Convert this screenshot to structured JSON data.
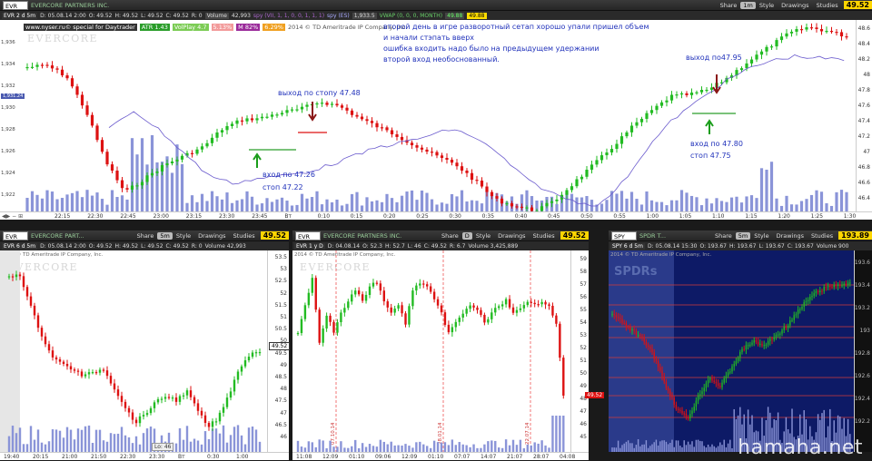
{
  "top": {
    "toolbar": {
      "symbol": "EVR",
      "company": "EVERCORE PARTNERS INC.",
      "share": "Share",
      "period": "1m",
      "style": "Style",
      "drawings": "Drawings",
      "studies": "Studies",
      "price": "49.52"
    },
    "quote": {
      "period_label": "EVR 2 d 5m",
      "d": "D: 05.08.14 2:00",
      "o": "O: 49.52",
      "h": "H: 49.52",
      "l": "L: 49.52",
      "c": "C: 49.52",
      "r": "R: 0",
      "volume_label": "Volume",
      "volume": "42,993",
      "study": "spy (VII, 1, 1, 0, 0, 1, 1, 1)",
      "study2": "spy (ES)",
      "study2_val": "1,933.5",
      "vwap": "VWAP (0, 0, 0, MONTH)",
      "vwap_v1": "49.88",
      "vwap_v2": "49.88"
    },
    "studies_row": {
      "site": "www.nyser.ru© special for Daytrader",
      "atr": "ATR 1.43",
      "volplay": "VolPlay 4.7",
      "pct1": "5.13%",
      "m": "M 82%",
      "pct2": "6.29%",
      "copyright": "2014 © TD Ameritrade IP Company, Inc."
    },
    "logo": "EVERCORE",
    "annotation_lines": [
      "второй день в игре разворотный сетап хорошо упали пришел объем",
      "и начали стэпать вверх",
      "ошибка входить надо было на предыдущем удержании",
      "второй вход необоснованный."
    ],
    "exit_stop": "выход по стопу 47.48",
    "entry1": "вход по 47.26",
    "stop1": "стоп 47.22",
    "exit2": "выход по47.95",
    "entry2": "вход по 47.80",
    "stop2": "стоп 47.75",
    "left_ticks": [
      "1,936",
      "1,934",
      "1,932",
      "1,930",
      "1,928",
      "1,926",
      "1,924",
      "1,922"
    ],
    "left_badge": "1,931.24",
    "right_ticks": [
      "48.6",
      "48.4",
      "48.2",
      "48",
      "47.8",
      "47.6",
      "47.4",
      "47.2",
      "47",
      "46.8",
      "46.6",
      "46.4"
    ],
    "time_ticks": [
      "22:15",
      "22:30",
      "22:45",
      "23:00",
      "23:15",
      "23:30",
      "23:45",
      "Вт",
      "0:10",
      "0:15",
      "0:20",
      "0:25",
      "0:30",
      "0:35",
      "0:40",
      "0:45",
      "0:50",
      "0:55",
      "1:00",
      "1:05",
      "1:10",
      "1:15",
      "1:20",
      "1:25",
      "1:30"
    ]
  },
  "p1": {
    "toolbar": {
      "symbol": "EVR",
      "company": "EVERCORE PART...",
      "share": "Share",
      "period": "5m",
      "style": "Style",
      "drawings": "Drawings",
      "studies": "Studies",
      "price": "49.52"
    },
    "quote": {
      "label": "EVR 6 d 5m",
      "d": "D: 05.08.14 2:00",
      "o": "O: 49.52",
      "h": "H: 49.52",
      "l": "L: 49.52",
      "c": "C: 49.52",
      "r": "R: 0",
      "vol": "Volume 42,993"
    },
    "copyright": "2014 © TD Ameritrade IP Company, Inc.",
    "logo": "EVERCORE",
    "ticks": [
      "53.5",
      "53",
      "52.5",
      "52",
      "51.5",
      "51",
      "50.5",
      "50",
      "49.5",
      "49",
      "48.5",
      "48",
      "47.5",
      "47",
      "46.5",
      "46"
    ],
    "badge": "49.52",
    "lo": "Lo: 46",
    "time_ticks": [
      "19:40",
      "20:15",
      "21:00",
      "21:50",
      "22:30",
      "23:30",
      "Вт",
      "0:30",
      "1:00"
    ]
  },
  "p2": {
    "toolbar": {
      "symbol": "EVR",
      "company": "EVERCORE PARTNERS INC.",
      "share": "Share",
      "period": "D",
      "style": "Style",
      "drawings": "Drawings",
      "studies": "Studies",
      "price": "49.52"
    },
    "quote": {
      "label": "EVR 1 y D",
      "d": "D: 04.08.14",
      "o": "O: 52.3",
      "h": "H: 52.7",
      "l": "L: 46",
      "c": "C: 49.52",
      "r": "R: 6.7",
      "vol": "Volume 3,425,889"
    },
    "copyright": "2014 © TD Ameritrade IP Company, Inc.",
    "logo": "EVERCORE",
    "ticks": [
      "59",
      "58",
      "57",
      "56",
      "55",
      "54",
      "53",
      "52",
      "51",
      "50",
      "49",
      "48",
      "47",
      "46",
      "45"
    ],
    "badge": "49.52",
    "date_labels": [
      "07.10.14",
      "28.01.14",
      "22.07.14"
    ],
    "time_ticks": [
      "11:08",
      "12:09",
      "01:10",
      "09:06",
      "12:09",
      "01:10",
      "07:07",
      "14:07",
      "21:07",
      "28:07",
      "04:08"
    ]
  },
  "p3": {
    "toolbar": {
      "symbol": "SPY",
      "company": "SPDR T...",
      "share": "Share",
      "period": "5m",
      "style": "Style",
      "drawings": "Drawings",
      "studies": "Studies",
      "price": "193.89"
    },
    "quote": {
      "label": "SPY 6 d 5m",
      "d": "D: 05.08.14 15:30",
      "o": "O: 193.67",
      "h": "H: 193.67",
      "l": "L: 193.67",
      "c": "C: 193.67",
      "vol": "Volume 900"
    },
    "copyright": "2014 © TD Ameritrade IP Company, Inc.",
    "logo": "SPDRs",
    "ticks": [
      "193.6",
      "193.4",
      "193.2",
      "193",
      "192.8",
      "192.6",
      "192.4",
      "192.2"
    ],
    "watermark": "hamaha.net"
  },
  "colors": {
    "up": "#22bb22",
    "down": "#dd1111",
    "volume": "#8a94d8",
    "annotation": "#2233bb",
    "dark_panel": "#0d1a66"
  }
}
